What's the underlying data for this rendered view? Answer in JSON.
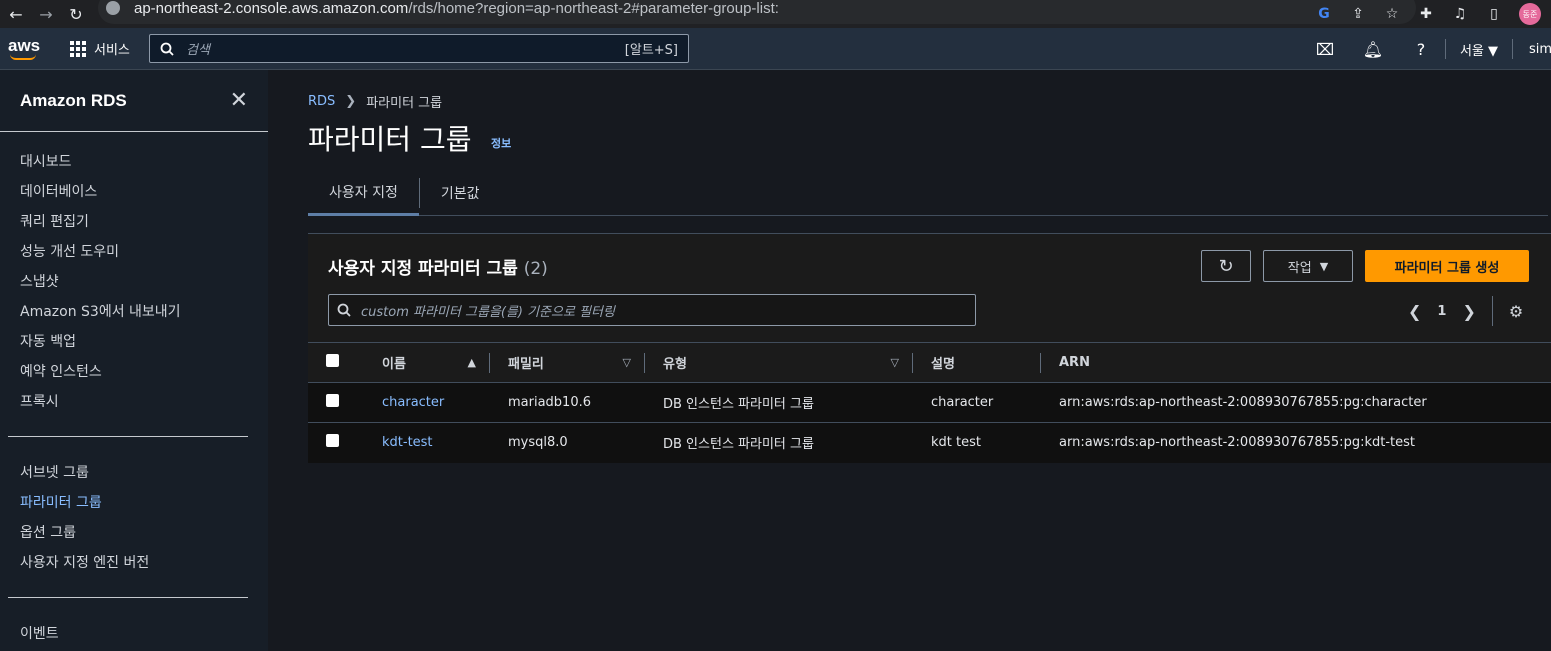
{
  "browser": {
    "url_host": "ap-northeast-2.console.aws.amazon.com",
    "url_path": "/rds/home?region=ap-northeast-2#parameter-group-list:",
    "avatar_text": "동준"
  },
  "aws_nav": {
    "logo": "aws",
    "services_label": "서비스",
    "search_placeholder": "검색",
    "search_shortcut": "[알트+S]",
    "region": "서울 ▼",
    "user": "sima"
  },
  "sidebar": {
    "title": "Amazon RDS",
    "group1": [
      "대시보드",
      "데이터베이스",
      "쿼리 편집기",
      "성능 개선 도우미",
      "스냅샷",
      "Amazon S3에서 내보내기",
      "자동 백업",
      "예약 인스턴스",
      "프록시"
    ],
    "group2": [
      "서브넷 그룹",
      "파라미터 그룹",
      "옵션 그룹",
      "사용자 지정 엔진 버전"
    ],
    "group3": [
      "이벤트"
    ]
  },
  "breadcrumb": {
    "root": "RDS",
    "current": "파라미터 그룹"
  },
  "page": {
    "title": "파라미터 그룹",
    "info": "정보"
  },
  "tabs": [
    "사용자 지정",
    "기본값"
  ],
  "panel": {
    "title": "사용자 지정 파라미터 그룹",
    "count": "(2)",
    "actions_label": "작업",
    "create_label": "파라미터 그룹 생성",
    "filter_placeholder": "custom 파라미터 그룹을(를) 기준으로 필터링",
    "page_number": "1"
  },
  "table": {
    "columns": [
      "이름",
      "패밀리",
      "유형",
      "설명",
      "ARN"
    ],
    "rows": [
      {
        "name": "character",
        "family": "mariadb10.6",
        "type": "DB 인스턴스 파라미터 그룹",
        "description": "character",
        "arn": "arn:aws:rds:ap-northeast-2:008930767855:pg:character"
      },
      {
        "name": "kdt-test",
        "family": "mysql8.0",
        "type": "DB 인스턴스 파라미터 그룹",
        "description": "kdt test",
        "arn": "arn:aws:rds:ap-northeast-2:008930767855:pg:kdt-test"
      }
    ]
  }
}
